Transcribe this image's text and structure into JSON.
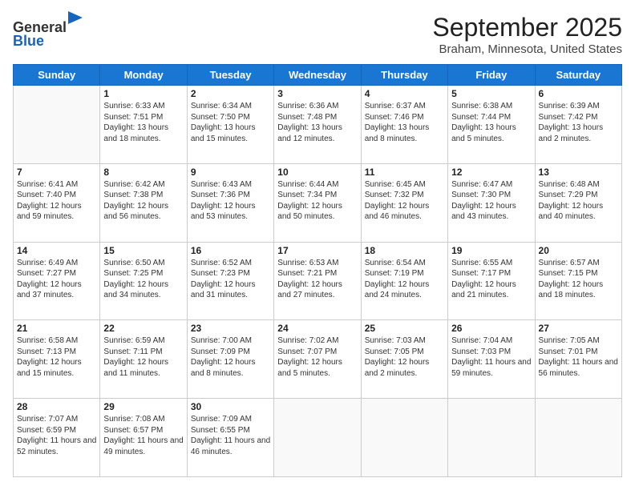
{
  "header": {
    "logo_line1": "General",
    "logo_line2": "Blue",
    "title": "September 2025",
    "subtitle": "Braham, Minnesota, United States"
  },
  "weekdays": [
    "Sunday",
    "Monday",
    "Tuesday",
    "Wednesday",
    "Thursday",
    "Friday",
    "Saturday"
  ],
  "weeks": [
    [
      {
        "day": "",
        "sunrise": "",
        "sunset": "",
        "daylight": ""
      },
      {
        "day": "1",
        "sunrise": "Sunrise: 6:33 AM",
        "sunset": "Sunset: 7:51 PM",
        "daylight": "Daylight: 13 hours and 18 minutes."
      },
      {
        "day": "2",
        "sunrise": "Sunrise: 6:34 AM",
        "sunset": "Sunset: 7:50 PM",
        "daylight": "Daylight: 13 hours and 15 minutes."
      },
      {
        "day": "3",
        "sunrise": "Sunrise: 6:36 AM",
        "sunset": "Sunset: 7:48 PM",
        "daylight": "Daylight: 13 hours and 12 minutes."
      },
      {
        "day": "4",
        "sunrise": "Sunrise: 6:37 AM",
        "sunset": "Sunset: 7:46 PM",
        "daylight": "Daylight: 13 hours and 8 minutes."
      },
      {
        "day": "5",
        "sunrise": "Sunrise: 6:38 AM",
        "sunset": "Sunset: 7:44 PM",
        "daylight": "Daylight: 13 hours and 5 minutes."
      },
      {
        "day": "6",
        "sunrise": "Sunrise: 6:39 AM",
        "sunset": "Sunset: 7:42 PM",
        "daylight": "Daylight: 13 hours and 2 minutes."
      }
    ],
    [
      {
        "day": "7",
        "sunrise": "Sunrise: 6:41 AM",
        "sunset": "Sunset: 7:40 PM",
        "daylight": "Daylight: 12 hours and 59 minutes."
      },
      {
        "day": "8",
        "sunrise": "Sunrise: 6:42 AM",
        "sunset": "Sunset: 7:38 PM",
        "daylight": "Daylight: 12 hours and 56 minutes."
      },
      {
        "day": "9",
        "sunrise": "Sunrise: 6:43 AM",
        "sunset": "Sunset: 7:36 PM",
        "daylight": "Daylight: 12 hours and 53 minutes."
      },
      {
        "day": "10",
        "sunrise": "Sunrise: 6:44 AM",
        "sunset": "Sunset: 7:34 PM",
        "daylight": "Daylight: 12 hours and 50 minutes."
      },
      {
        "day": "11",
        "sunrise": "Sunrise: 6:45 AM",
        "sunset": "Sunset: 7:32 PM",
        "daylight": "Daylight: 12 hours and 46 minutes."
      },
      {
        "day": "12",
        "sunrise": "Sunrise: 6:47 AM",
        "sunset": "Sunset: 7:30 PM",
        "daylight": "Daylight: 12 hours and 43 minutes."
      },
      {
        "day": "13",
        "sunrise": "Sunrise: 6:48 AM",
        "sunset": "Sunset: 7:29 PM",
        "daylight": "Daylight: 12 hours and 40 minutes."
      }
    ],
    [
      {
        "day": "14",
        "sunrise": "Sunrise: 6:49 AM",
        "sunset": "Sunset: 7:27 PM",
        "daylight": "Daylight: 12 hours and 37 minutes."
      },
      {
        "day": "15",
        "sunrise": "Sunrise: 6:50 AM",
        "sunset": "Sunset: 7:25 PM",
        "daylight": "Daylight: 12 hours and 34 minutes."
      },
      {
        "day": "16",
        "sunrise": "Sunrise: 6:52 AM",
        "sunset": "Sunset: 7:23 PM",
        "daylight": "Daylight: 12 hours and 31 minutes."
      },
      {
        "day": "17",
        "sunrise": "Sunrise: 6:53 AM",
        "sunset": "Sunset: 7:21 PM",
        "daylight": "Daylight: 12 hours and 27 minutes."
      },
      {
        "day": "18",
        "sunrise": "Sunrise: 6:54 AM",
        "sunset": "Sunset: 7:19 PM",
        "daylight": "Daylight: 12 hours and 24 minutes."
      },
      {
        "day": "19",
        "sunrise": "Sunrise: 6:55 AM",
        "sunset": "Sunset: 7:17 PM",
        "daylight": "Daylight: 12 hours and 21 minutes."
      },
      {
        "day": "20",
        "sunrise": "Sunrise: 6:57 AM",
        "sunset": "Sunset: 7:15 PM",
        "daylight": "Daylight: 12 hours and 18 minutes."
      }
    ],
    [
      {
        "day": "21",
        "sunrise": "Sunrise: 6:58 AM",
        "sunset": "Sunset: 7:13 PM",
        "daylight": "Daylight: 12 hours and 15 minutes."
      },
      {
        "day": "22",
        "sunrise": "Sunrise: 6:59 AM",
        "sunset": "Sunset: 7:11 PM",
        "daylight": "Daylight: 12 hours and 11 minutes."
      },
      {
        "day": "23",
        "sunrise": "Sunrise: 7:00 AM",
        "sunset": "Sunset: 7:09 PM",
        "daylight": "Daylight: 12 hours and 8 minutes."
      },
      {
        "day": "24",
        "sunrise": "Sunrise: 7:02 AM",
        "sunset": "Sunset: 7:07 PM",
        "daylight": "Daylight: 12 hours and 5 minutes."
      },
      {
        "day": "25",
        "sunrise": "Sunrise: 7:03 AM",
        "sunset": "Sunset: 7:05 PM",
        "daylight": "Daylight: 12 hours and 2 minutes."
      },
      {
        "day": "26",
        "sunrise": "Sunrise: 7:04 AM",
        "sunset": "Sunset: 7:03 PM",
        "daylight": "Daylight: 11 hours and 59 minutes."
      },
      {
        "day": "27",
        "sunrise": "Sunrise: 7:05 AM",
        "sunset": "Sunset: 7:01 PM",
        "daylight": "Daylight: 11 hours and 56 minutes."
      }
    ],
    [
      {
        "day": "28",
        "sunrise": "Sunrise: 7:07 AM",
        "sunset": "Sunset: 6:59 PM",
        "daylight": "Daylight: 11 hours and 52 minutes."
      },
      {
        "day": "29",
        "sunrise": "Sunrise: 7:08 AM",
        "sunset": "Sunset: 6:57 PM",
        "daylight": "Daylight: 11 hours and 49 minutes."
      },
      {
        "day": "30",
        "sunrise": "Sunrise: 7:09 AM",
        "sunset": "Sunset: 6:55 PM",
        "daylight": "Daylight: 11 hours and 46 minutes."
      },
      {
        "day": "",
        "sunrise": "",
        "sunset": "",
        "daylight": ""
      },
      {
        "day": "",
        "sunrise": "",
        "sunset": "",
        "daylight": ""
      },
      {
        "day": "",
        "sunrise": "",
        "sunset": "",
        "daylight": ""
      },
      {
        "day": "",
        "sunrise": "",
        "sunset": "",
        "daylight": ""
      }
    ]
  ]
}
